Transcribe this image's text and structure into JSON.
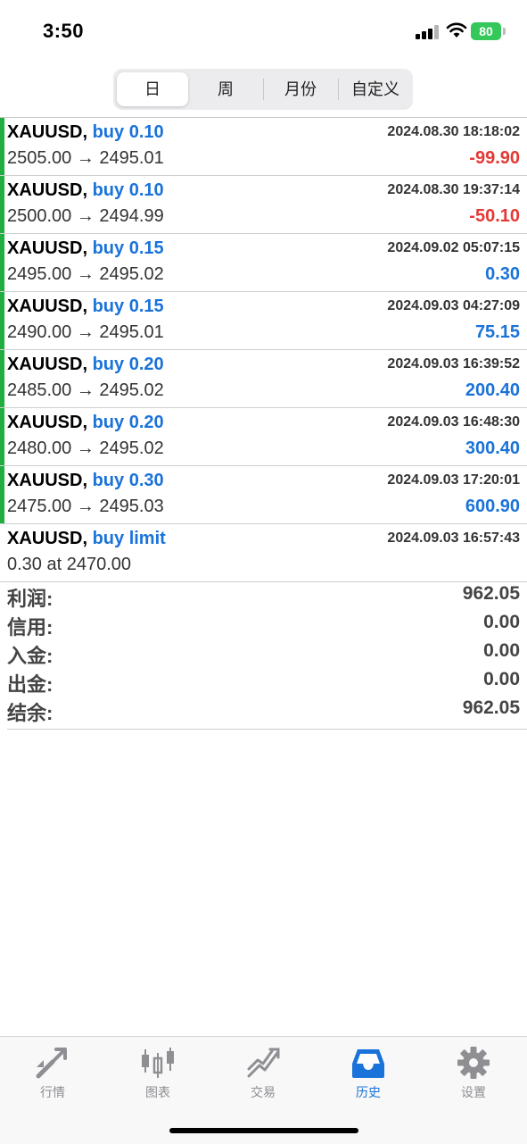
{
  "status_bar": {
    "time": "3:50",
    "battery": "80"
  },
  "segments": [
    {
      "label": "日",
      "active": true
    },
    {
      "label": "周",
      "active": false
    },
    {
      "label": "月份",
      "active": false
    },
    {
      "label": "自定义",
      "active": false
    }
  ],
  "trades": [
    {
      "symbol": "XAUUSD,",
      "side": "buy 0.10",
      "prices": "2505.00 → 2495.01",
      "time": "2024.08.30 18:18:02",
      "profit": "-99.90",
      "profit_sign": "neg"
    },
    {
      "symbol": "XAUUSD,",
      "side": "buy 0.10",
      "prices": "2500.00 → 2494.99",
      "time": "2024.08.30 19:37:14",
      "profit": "-50.10",
      "profit_sign": "neg"
    },
    {
      "symbol": "XAUUSD,",
      "side": "buy 0.15",
      "prices": "2495.00 → 2495.02",
      "time": "2024.09.02 05:07:15",
      "profit": "0.30",
      "profit_sign": "pos"
    },
    {
      "symbol": "XAUUSD,",
      "side": "buy 0.15",
      "prices": "2490.00 → 2495.01",
      "time": "2024.09.03 04:27:09",
      "profit": "75.15",
      "profit_sign": "pos"
    },
    {
      "symbol": "XAUUSD,",
      "side": "buy 0.20",
      "prices": "2485.00 → 2495.02",
      "time": "2024.09.03 16:39:52",
      "profit": "200.40",
      "profit_sign": "pos"
    },
    {
      "symbol": "XAUUSD,",
      "side": "buy 0.20",
      "prices": "2480.00 → 2495.02",
      "time": "2024.09.03 16:48:30",
      "profit": "300.40",
      "profit_sign": "pos"
    },
    {
      "symbol": "XAUUSD,",
      "side": "buy 0.30",
      "prices": "2475.00 → 2495.03",
      "time": "2024.09.03 17:20:01",
      "profit": "600.90",
      "profit_sign": "pos"
    }
  ],
  "order": {
    "symbol": "XAUUSD,",
    "side": "buy limit",
    "details": "0.30 at 2470.00",
    "time": "2024.09.03 16:57:43"
  },
  "summary": [
    {
      "label": "利润:",
      "value": "962.05"
    },
    {
      "label": "信用:",
      "value": "0.00"
    },
    {
      "label": "入金:",
      "value": "0.00"
    },
    {
      "label": "出金:",
      "value": "0.00"
    },
    {
      "label": "结余:",
      "value": "962.05"
    }
  ],
  "tabs": [
    {
      "label": "行情",
      "icon": "quotes-icon",
      "active": false
    },
    {
      "label": "图表",
      "icon": "chart-icon",
      "active": false
    },
    {
      "label": "交易",
      "icon": "trade-icon",
      "active": false
    },
    {
      "label": "历史",
      "icon": "history-icon",
      "active": true
    },
    {
      "label": "设置",
      "icon": "settings-icon",
      "active": false
    }
  ],
  "colors": {
    "accent": "#1a73d9",
    "loss": "#e53935",
    "buy_bar": "#1fae3f",
    "battery": "#34c759"
  }
}
